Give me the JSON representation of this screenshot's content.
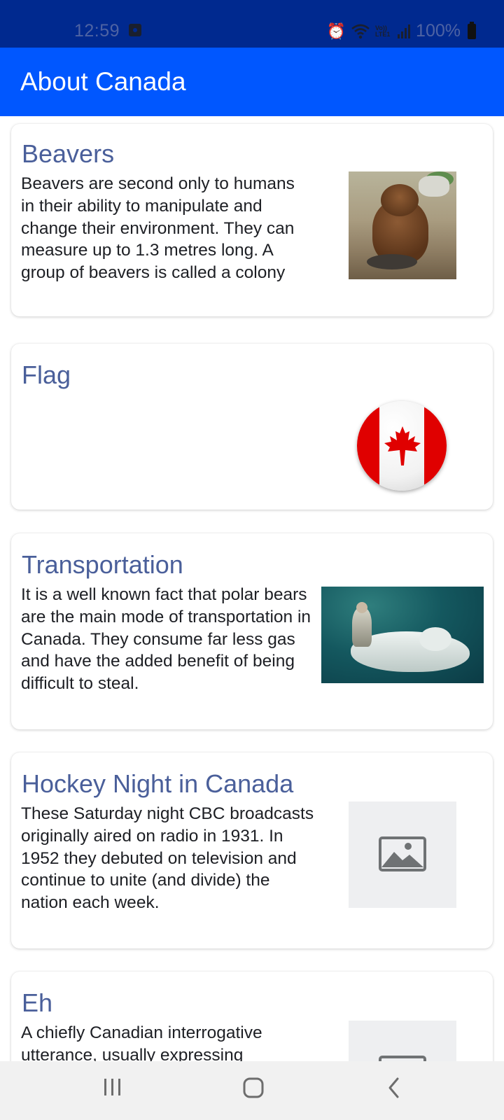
{
  "status_bar": {
    "time": "12:59",
    "battery_text": "100%",
    "icons": [
      "notification-icon",
      "alarm-icon",
      "wifi-icon",
      "volte-icon",
      "signal-icon",
      "battery-icon"
    ],
    "volte_label": "Vo)) LTE1"
  },
  "app_bar": {
    "title": "About Canada",
    "color": "#0057ff"
  },
  "cards": [
    {
      "title": "Beavers",
      "description": "Beavers are second only to humans in their ability to manipulate and change their environment. They can measure up to 1.3 metres long. A group of beavers is called a colony",
      "image": "beaver-photo"
    },
    {
      "title": "Flag",
      "description": "",
      "image": "canada-flag"
    },
    {
      "title": "Transportation",
      "description": "It is a well known fact that polar bears are the main mode of transportation in Canada. They consume far less gas and have the added benefit of being difficult to steal.",
      "image": "polar-bear-photo"
    },
    {
      "title": "Hockey Night in Canada",
      "description": "These Saturday night CBC broadcasts originally aired on radio in 1931. In 1952 they debuted on television and continue to unite (and divide) the nation each week.",
      "image": "image-placeholder-icon"
    },
    {
      "title": "Eh",
      "description": "A chiefly Canadian interrogative utterance, usually expressing",
      "image": "image-placeholder-icon"
    }
  ],
  "colors": {
    "status_bar": "#00298f",
    "card_title": "#4a5f9a",
    "text": "#1d1f24",
    "nav_bar": "#f1f1f1"
  },
  "nav_bar": {
    "buttons": [
      "recent-apps-button",
      "home-button",
      "back-button"
    ]
  }
}
